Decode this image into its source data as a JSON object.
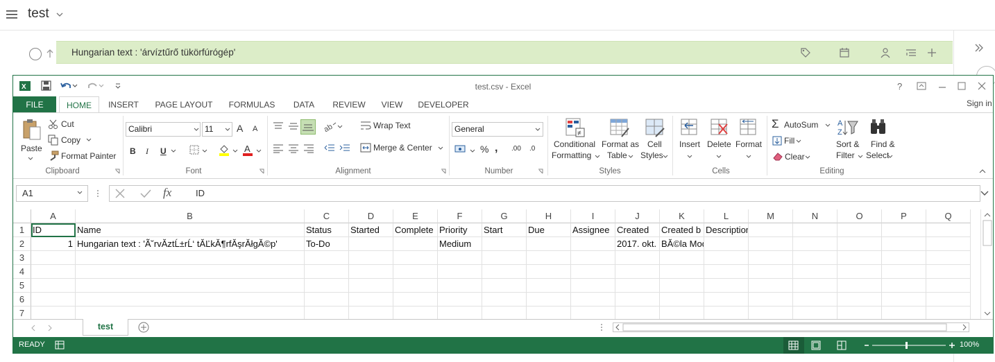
{
  "app": {
    "title": "test"
  },
  "task": {
    "text": "Hungarian text : 'árvíztűrő tükörfúrógép'"
  },
  "excel": {
    "window_title": "test.csv - Excel",
    "help": "?",
    "sign_in": "Sign in",
    "tabs": [
      "FILE",
      "HOME",
      "INSERT",
      "PAGE LAYOUT",
      "FORMULAS",
      "DATA",
      "REVIEW",
      "VIEW",
      "DEVELOPER"
    ],
    "clipboard": {
      "paste": "Paste",
      "cut": "Cut",
      "copy": "Copy",
      "format_painter": "Format Painter",
      "label": "Clipboard"
    },
    "font": {
      "name": "Calibri",
      "size": "11",
      "bold": "B",
      "italic": "I",
      "underline": "U",
      "label": "Font",
      "grow": "A",
      "shrink": "A"
    },
    "alignment": {
      "wrap": "Wrap Text",
      "merge": "Merge & Center",
      "label": "Alignment"
    },
    "number": {
      "format": "General",
      "percent": "%",
      "comma": ",",
      "label": "Number",
      "inc": ".00",
      "dec": ".0"
    },
    "styles": {
      "conditional1": "Conditional",
      "conditional2": "Formatting",
      "format_table1": "Format as",
      "format_table2": "Table",
      "cell_styles1": "Cell",
      "cell_styles2": "Styles",
      "label": "Styles"
    },
    "cells": {
      "insert": "Insert",
      "delete": "Delete",
      "format": "Format",
      "label": "Cells"
    },
    "editing": {
      "autosum": "AutoSum",
      "fill": "Fill",
      "clear": "Clear",
      "sort1": "Sort &",
      "sort2": "Filter",
      "find1": "Find &",
      "find2": "Select",
      "label": "Editing"
    },
    "formula_bar": {
      "name_box": "A1",
      "fx": "fx",
      "formula": "ID"
    },
    "columns": [
      "A",
      "B",
      "C",
      "D",
      "E",
      "F",
      "G",
      "H",
      "I",
      "J",
      "K",
      "L",
      "M",
      "N",
      "O",
      "P",
      "Q"
    ],
    "rows": [
      "1",
      "2",
      "3",
      "4",
      "5",
      "6",
      "7"
    ],
    "header_row": [
      "ID",
      "Name",
      "Status",
      "Started",
      "Complete",
      "Priority",
      "Start",
      "Due",
      "Assignee",
      "Created",
      "Created b",
      "Description"
    ],
    "data_row": [
      "1",
      "Hungarian text : 'Ã˘rvĂ­ztĹ±rĹ‘ tĂĽkĂ¶rfĂşrĂłgĂ©p'",
      "To-Do",
      "",
      "",
      "Medium",
      "",
      "",
      "",
      "2017. okt.",
      "BĂ©la Moqs",
      ""
    ],
    "sheet": "test",
    "status": {
      "ready": "READY",
      "zoom": "100%"
    }
  }
}
